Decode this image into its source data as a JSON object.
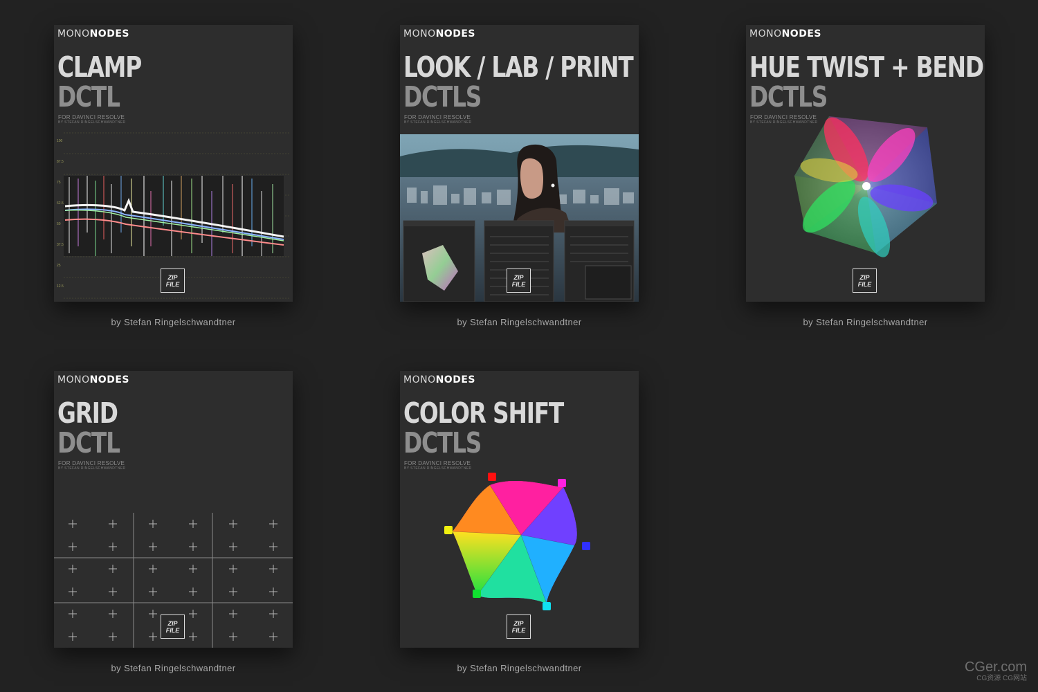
{
  "cards": [
    {
      "brand_mono": "MONO",
      "brand_nodes": "NODES",
      "title_line1": "CLAMP",
      "title_line2": "DCTL",
      "subtitle": "FOR DAVINCI RESOLVE",
      "byline_small": "BY STEFAN RINGELSCHWANDTNER",
      "zip_line1": "ZIP",
      "zip_line2": "FILE",
      "author": "by Stefan Ringelschwandtner",
      "scale_labels": [
        "100",
        "87.5",
        "75",
        "62.5",
        "50",
        "37.5",
        "25",
        "12.5",
        "0"
      ]
    },
    {
      "brand_mono": "MONO",
      "brand_nodes": "NODES",
      "title_line1": "LOOK / LAB / PRINT",
      "title_line2": "DCTLS",
      "subtitle": "FOR DAVINCI RESOLVE",
      "byline_small": "BY STEFAN RINGELSCHWANDTNER",
      "zip_line1": "ZIP",
      "zip_line2": "FILE",
      "author": "by Stefan Ringelschwandtner"
    },
    {
      "brand_mono": "MONO",
      "brand_nodes": "NODES",
      "title_line1": "HUE TWIST + BEND",
      "title_line2": "DCTLS",
      "subtitle": "FOR DAVINCI RESOLVE",
      "byline_small": "BY STEFAN RINGELSCHWANDTNER",
      "zip_line1": "ZIP",
      "zip_line2": "FILE",
      "author": "by Stefan Ringelschwandtner"
    },
    {
      "brand_mono": "MONO",
      "brand_nodes": "NODES",
      "title_line1": "GRID",
      "title_line2": "DCTL",
      "subtitle": "FOR DAVINCI RESOLVE",
      "byline_small": "BY STEFAN RINGELSCHWANDTNER",
      "zip_line1": "ZIP",
      "zip_line2": "FILE",
      "author": "by Stefan Ringelschwandtner"
    },
    {
      "brand_mono": "MONO",
      "brand_nodes": "NODES",
      "title_line1": "COLOR SHIFT",
      "title_line2": "DCTLS",
      "subtitle": "FOR DAVINCI RESOLVE",
      "byline_small": "BY STEFAN RINGELSCHWANDTNER",
      "zip_line1": "ZIP",
      "zip_line2": "FILE",
      "author": "by Stefan Ringelschwandtner"
    }
  ],
  "watermark": {
    "main": "CGer.com",
    "sub": "CG资源 CG网站"
  },
  "colors": {
    "background": "#222222",
    "card": "#2d2d2d",
    "title_primary": "#d9d9d9",
    "title_secondary": "#8e8e8e"
  }
}
